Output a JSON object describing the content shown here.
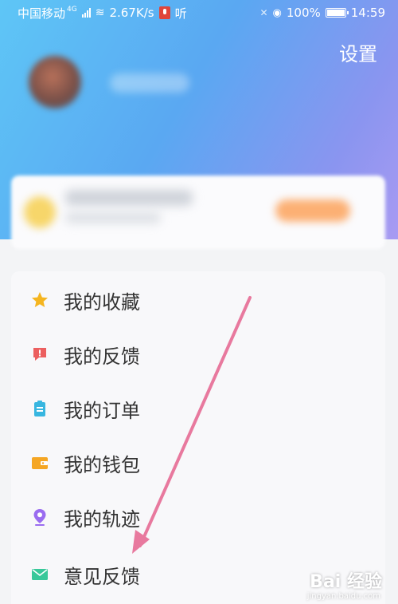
{
  "status_bar": {
    "carrier": "中国移动",
    "network": "4G",
    "speed": "2.67K/s",
    "listen": "听",
    "battery": "100%",
    "time": "14:59",
    "icons": [
      "signal-icon",
      "wifi-icon",
      "mic-icon",
      "location-icon",
      "battery-icon"
    ]
  },
  "header": {
    "settings_label": "设置"
  },
  "menu": {
    "items": [
      {
        "label": "我的收藏",
        "icon": "star-icon",
        "color": "#f5b51f"
      },
      {
        "label": "我的反馈",
        "icon": "feedback-icon",
        "color": "#ec5f5f"
      },
      {
        "label": "我的订单",
        "icon": "clipboard-icon",
        "color": "#38b6e0"
      },
      {
        "label": "我的钱包",
        "icon": "wallet-icon",
        "color": "#f5a623"
      },
      {
        "label": "我的轨迹",
        "icon": "location-pin-icon",
        "color": "#9a6cf0"
      },
      {
        "label": "意见反馈",
        "icon": "mail-icon",
        "color": "#38c89a"
      }
    ]
  },
  "watermark": {
    "text": "Bai 经验",
    "sub": "jingyan.baidu.com"
  },
  "colors": {
    "header_start": "#5ec6f6",
    "header_end": "#a89af2",
    "arrow": "#e8799e"
  }
}
